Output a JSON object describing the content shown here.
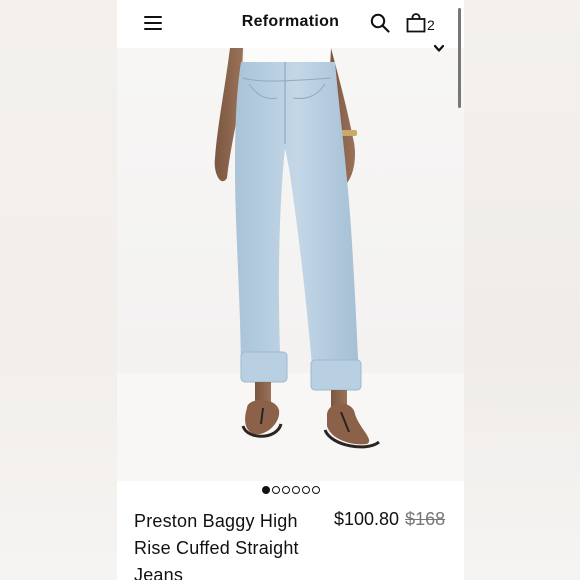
{
  "header": {
    "brand": "Reformation",
    "bag_count": "2"
  },
  "icons": {
    "menu": "hamburger-menu-icon",
    "search": "search-icon",
    "bag": "shopping-bag-icon",
    "chevron": "chevron-down-icon"
  },
  "carousel": {
    "total": 6,
    "active_index": 0
  },
  "product": {
    "name": "Preston Baggy High Rise Cuffed Straight Jeans",
    "price": "$100.80",
    "original_price": "$168"
  },
  "colors": {
    "denim": "#b5cde0",
    "background": "#ffffff",
    "text": "#111111",
    "muted": "#777777"
  }
}
